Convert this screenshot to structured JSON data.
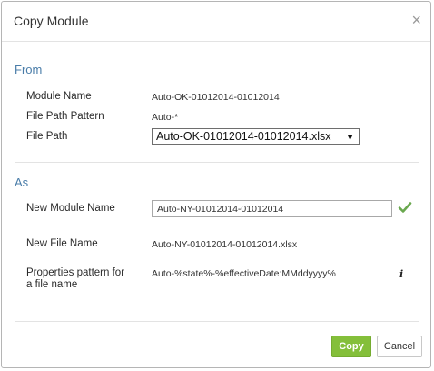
{
  "dialog": {
    "title": "Copy Module",
    "close_glyph": "×"
  },
  "from": {
    "heading": "From",
    "module_name_label": "Module Name",
    "module_name_value": "Auto-OK-01012014-01012014",
    "file_path_pattern_label": "File Path Pattern",
    "file_path_pattern_value": "Auto-*",
    "file_path_label": "File Path",
    "file_path_selected": "Auto-OK-01012014-01012014.xlsx"
  },
  "as": {
    "heading": "As",
    "new_module_name_label": "New Module Name",
    "new_module_name_value": "Auto-NY-01012014-01012014",
    "new_file_name_label": "New File Name",
    "new_file_name_value": "Auto-NY-01012014-01012014.xlsx",
    "properties_pattern_label_line1": "Properties pattern for",
    "properties_pattern_label_line2": "a file name",
    "properties_pattern_value": "Auto-%state%-%effectiveDate:MMddyyyy%",
    "info_glyph": "i"
  },
  "footer": {
    "copy_label": "Copy",
    "cancel_label": "Cancel"
  },
  "icons": {
    "valid": "check-icon",
    "info": "info-icon",
    "close": "close-icon",
    "dropdown": "caret-down-icon"
  },
  "colors": {
    "section_heading": "#4a7da9",
    "primary_button": "#84bf3a",
    "check": "#6aa84f"
  }
}
